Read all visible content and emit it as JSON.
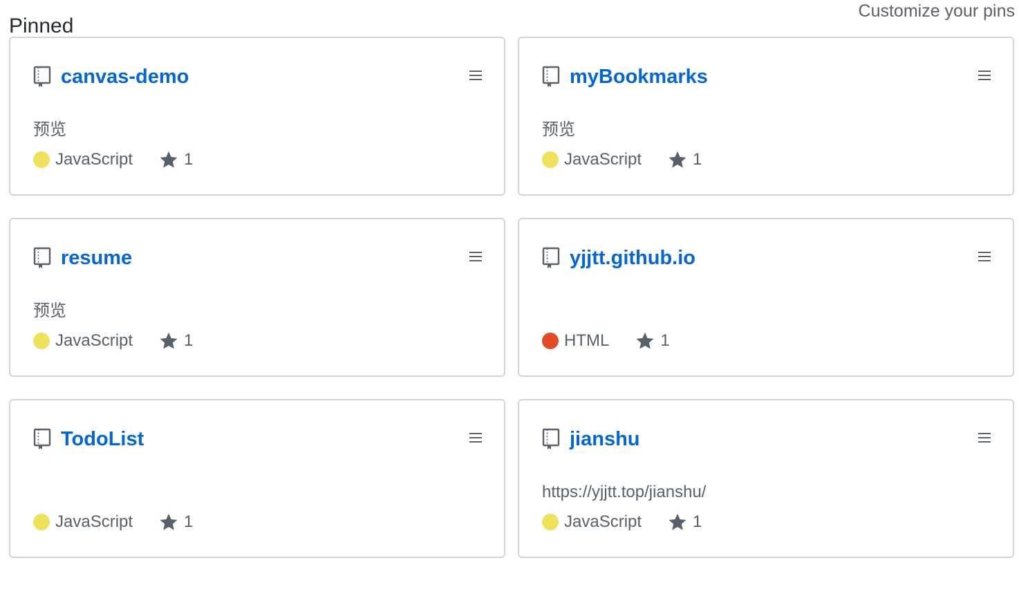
{
  "header": {
    "title": "Pinned",
    "customize_label": "Customize your pins"
  },
  "pins": [
    {
      "name": "canvas-demo",
      "description": "预览",
      "language": "JavaScript",
      "language_color": "#f1e05a",
      "stars": "1"
    },
    {
      "name": "myBookmarks",
      "description": "预览",
      "language": "JavaScript",
      "language_color": "#f1e05a",
      "stars": "1"
    },
    {
      "name": "resume",
      "description": "预览",
      "language": "JavaScript",
      "language_color": "#f1e05a",
      "stars": "1"
    },
    {
      "name": "yjjtt.github.io",
      "description": "",
      "language": "HTML",
      "language_color": "#e34c26",
      "stars": "1"
    },
    {
      "name": "TodoList",
      "description": "",
      "language": "JavaScript",
      "language_color": "#f1e05a",
      "stars": "1"
    },
    {
      "name": "jianshu",
      "description": "https://yjjtt.top/jianshu/",
      "language": "JavaScript",
      "language_color": "#f1e05a",
      "stars": "1"
    }
  ],
  "icons": {
    "repo": "repo-icon",
    "drag": "grabber-icon",
    "star": "star-icon"
  },
  "colors": {
    "link": "#0366d6",
    "muted_text": "#586069",
    "border": "#d1d5da"
  }
}
